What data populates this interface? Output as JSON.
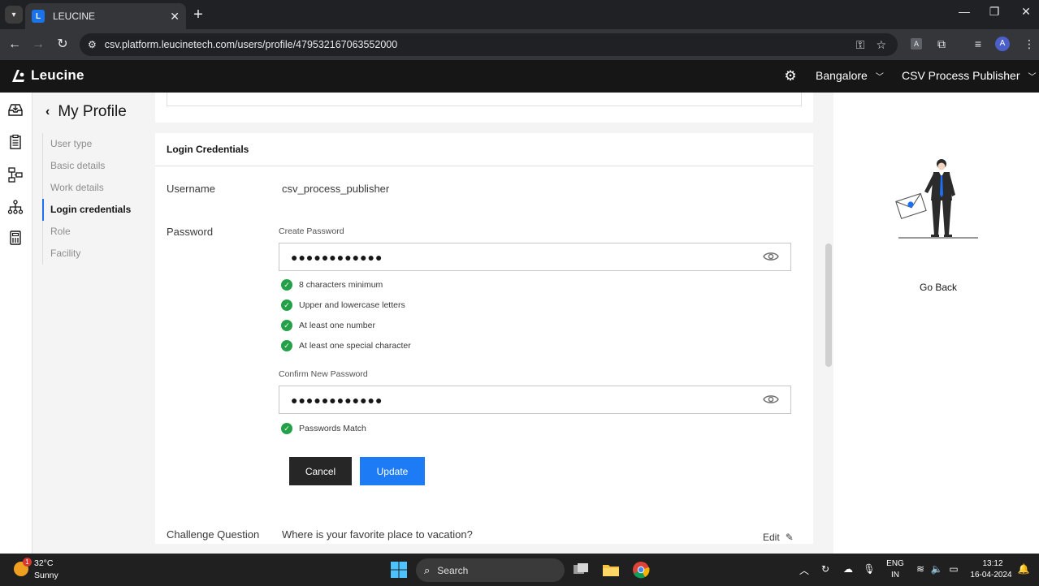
{
  "browser": {
    "tab_title": "LEUCINE",
    "favicon_letter": "L",
    "url": "csv.platform.leucinetech.com/users/profile/479532167063552000",
    "profile_initial": "A",
    "ext_label": "A"
  },
  "app": {
    "brand": "Leucine",
    "facility": "Bangalore",
    "role_selector": "CSV Process Publisher"
  },
  "profile": {
    "title": "My Profile",
    "nav": [
      {
        "label": "User type"
      },
      {
        "label": "Basic details"
      },
      {
        "label": "Work details"
      },
      {
        "label": "Login credentials"
      },
      {
        "label": "Role"
      },
      {
        "label": "Facility"
      }
    ]
  },
  "credentials": {
    "section_title": "Login Credentials",
    "username_label": "Username",
    "username_value": "csv_process_publisher",
    "password_label": "Password",
    "create_password_label": "Create Password",
    "create_password_value": "●●●●●●●●●●●●",
    "requirements": [
      "8 characters minimum",
      "Upper and lowercase letters",
      "At least one number",
      "At least one special character"
    ],
    "confirm_password_label": "Confirm New Password",
    "confirm_password_value": "●●●●●●●●●●●●",
    "match_text": "Passwords Match",
    "cancel_label": "Cancel",
    "update_label": "Update",
    "challenge_label": "Challenge Question",
    "challenge_value": "Where is your favorite place to vacation?",
    "edit_label": "Edit"
  },
  "right_panel": {
    "go_back": "Go Back"
  },
  "taskbar": {
    "temperature": "32°C",
    "condition": "Sunny",
    "weather_badge": "1",
    "search_label": "Search",
    "lang_top": "ENG",
    "lang_bottom": "IN",
    "time": "13:12",
    "date": "16-04-2024"
  },
  "colors": {
    "accent": "#1d7cf5",
    "success": "#24a148",
    "header_bg": "#161616",
    "cancel_bg": "#262626"
  }
}
